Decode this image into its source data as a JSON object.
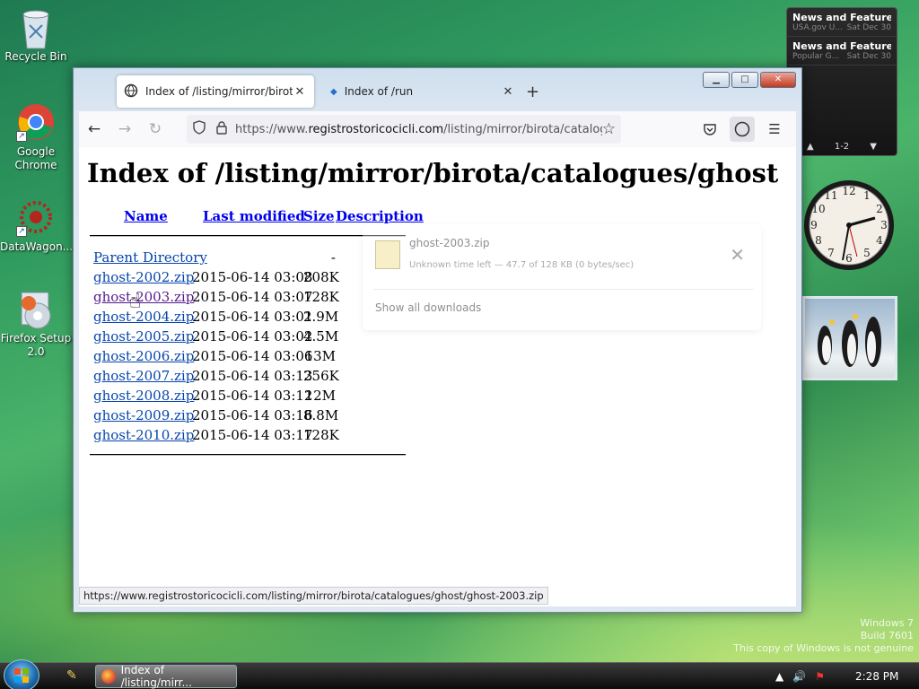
{
  "desktop": {
    "icons": [
      {
        "label": "Recycle Bin",
        "icon": "recycle-bin-icon"
      },
      {
        "label": "Google Chrome",
        "icon": "chrome-icon"
      },
      {
        "label": "DataWagon...",
        "icon": "datawagon-icon"
      },
      {
        "label": "Firefox Setup 2.0",
        "icon": "firefox-setup-icon"
      }
    ],
    "watermark": {
      "line1": "Windows 7",
      "line2": "Build 7601",
      "line3": "This copy of Windows is not genuine"
    }
  },
  "gadgets": {
    "news": [
      {
        "title": "News and Features f...",
        "source": "USA.gov U...",
        "date": "Sat Dec 30"
      },
      {
        "title": "News and Feature...",
        "source": "Popular G...",
        "date": "Sat Dec 30"
      }
    ],
    "news_page": "1-2"
  },
  "browser": {
    "tabs": [
      {
        "title": "Index of /listing/mirror/birota/c",
        "active": true
      },
      {
        "title": "Index of /run",
        "active": false
      }
    ],
    "url_prefix": "https://www.",
    "url_host": "registrostoricocicli.com",
    "url_path": "/listing/mirror/birota/catalogue",
    "status_url": "https://www.registrostoricocicli.com/listing/mirror/birota/catalogues/ghost/ghost-2003.zip"
  },
  "page": {
    "title": "Index of /listing/mirror/birota/catalogues/ghost",
    "headers": {
      "name": "Name",
      "modified": "Last modified",
      "size": "Size",
      "description": "Description"
    },
    "parent": {
      "name": "Parent Directory",
      "size": "-"
    },
    "files": [
      {
        "name": "ghost-2002.zip",
        "modified": "2015-06-14 03:08",
        "size": "208K"
      },
      {
        "name": "ghost-2003.zip",
        "modified": "2015-06-14 03:07",
        "size": "128K"
      },
      {
        "name": "ghost-2004.zip",
        "modified": "2015-06-14 03:01",
        "size": "2.9M"
      },
      {
        "name": "ghost-2005.zip",
        "modified": "2015-06-14 03:02",
        "size": "4.5M"
      },
      {
        "name": "ghost-2006.zip",
        "modified": "2015-06-14 03:06",
        "size": "13M"
      },
      {
        "name": "ghost-2007.zip",
        "modified": "2015-06-14 03:13",
        "size": "256K"
      },
      {
        "name": "ghost-2008.zip",
        "modified": "2015-06-14 03:12",
        "size": "12M"
      },
      {
        "name": "ghost-2009.zip",
        "modified": "2015-06-14 03:16",
        "size": "8.8M"
      },
      {
        "name": "ghost-2010.zip",
        "modified": "2015-06-14 03:17",
        "size": "128K"
      }
    ]
  },
  "downloads": {
    "file": "ghost-2003.zip",
    "status": "Unknown time left — 47.7 of 128 KB (0 bytes/sec)",
    "show_all": "Show all downloads"
  },
  "taskbar": {
    "task_label": "Index of /listing/mirr...",
    "time": "2:28 PM"
  }
}
